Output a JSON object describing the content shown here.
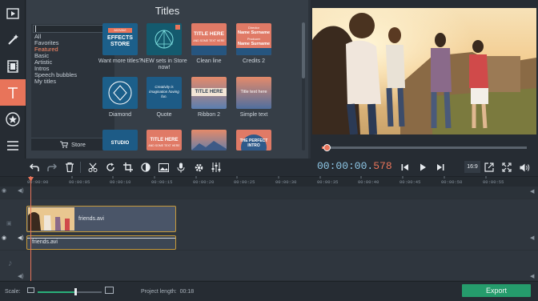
{
  "left_tools": [
    {
      "name": "import-media-icon"
    },
    {
      "name": "magic-wand-icon"
    },
    {
      "name": "filmstrip-icon"
    },
    {
      "name": "text-titles-icon",
      "active": true
    },
    {
      "name": "star-stickers-icon"
    },
    {
      "name": "more-menu-icon"
    }
  ],
  "titles_panel": {
    "heading": "Titles",
    "categories": [
      "All",
      "Favorites",
      "Featured",
      "Basic",
      "Artistic",
      "Intros",
      "Speech bubbles",
      "My titles"
    ],
    "selected_category": "Featured",
    "store_button": "Store",
    "tiles": [
      {
        "label": "Want more titles?",
        "preview_text": "EFFECTS STORE",
        "preview_kicker": "MOVAVI",
        "bg": "#1c5f8a"
      },
      {
        "label": "NEW sets in Store now!",
        "preview_text": "",
        "bg": "#145a6e"
      },
      {
        "label": "Clean line",
        "preview_text": "TITLE HERE",
        "preview_sub": "AND SOME TEXT HERE",
        "bg": "#e07a66"
      },
      {
        "label": "Credits 2",
        "preview_text": "Name Surname",
        "preview_kicker": "Director",
        "preview_sub": "Producer",
        "bg": "#e07a66"
      },
      {
        "label": "Diamond",
        "preview_text": "",
        "bg": "#1c5f8a"
      },
      {
        "label": "Quote",
        "preview_text": "Creativity is imagination having fun.",
        "bg": "#1d5b86"
      },
      {
        "label": "Ribbon 2",
        "preview_text": "TITLE HERE",
        "bg": "#3a6a9a"
      },
      {
        "label": "Simple text",
        "preview_text": "Title text here",
        "bg": "#3a6a9a"
      },
      {
        "label": "",
        "preview_text": "STUDIO",
        "bg": "#1d5b86"
      },
      {
        "label": "",
        "preview_text": "TITLE HERE",
        "preview_sub": "AND SOME TEXT HERE",
        "bg": "#e07a66"
      },
      {
        "label": "",
        "preview_text": "",
        "bg": "#6a7fa6"
      },
      {
        "label": "",
        "preview_text": "THE PERFECT INTRO",
        "bg": "#e07a66"
      }
    ]
  },
  "toolbar": {
    "buttons": [
      "undo-icon",
      "redo-icon",
      "trash-icon",
      "cut-icon",
      "rotate-icon",
      "crop-icon",
      "color-adjust-icon",
      "image-icon",
      "microphone-icon",
      "settings-icon",
      "equalizer-icon"
    ],
    "timecode_main": "00:00:00.",
    "timecode_ms": "578",
    "aspect_ratio": "16:9"
  },
  "timeline": {
    "ticks": [
      "00:00:00",
      "00:00:05",
      "00:00:10",
      "00:00:15",
      "00:00:20",
      "00:00:25",
      "00:00:30",
      "00:00:35",
      "00:00:40",
      "00:00:45",
      "00:00:50",
      "00:00:55"
    ],
    "video_clip": "friends.avi",
    "audio_clip": "friends.avi"
  },
  "bottom": {
    "scale_label": "Scale:",
    "project_length_label": "Project length:",
    "project_length_value": "00:18",
    "export_button": "Export"
  },
  "colors": {
    "accent": "#e8745a",
    "export": "#259c6c",
    "timecode": "#8ec7e6",
    "clip_border": "#c89a3a"
  }
}
